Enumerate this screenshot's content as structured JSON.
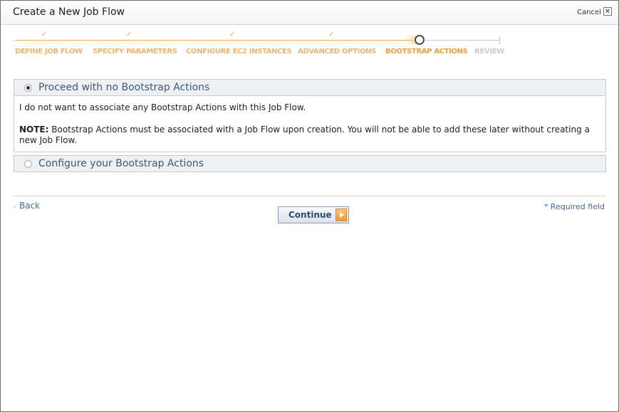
{
  "dialog": {
    "title": "Create a New Job Flow",
    "cancel_label": "Cancel",
    "close_glyph": "✕"
  },
  "wizard": {
    "steps": [
      {
        "label": "DEFINE JOB FLOW",
        "state": "done",
        "marker": "✓"
      },
      {
        "label": "SPECIFY PARAMETERS",
        "state": "done",
        "marker": "✓"
      },
      {
        "label": "CONFIGURE EC2 INSTANCES",
        "state": "done",
        "marker": "✓"
      },
      {
        "label": "ADVANCED OPTIONS",
        "state": "done",
        "marker": "✓"
      },
      {
        "label": "BOOTSTRAP ACTIONS",
        "state": "current"
      },
      {
        "label": "REVIEW",
        "state": "future"
      }
    ],
    "colors": {
      "done": "#f2b46b",
      "current": "#ef9e3c",
      "future": "#c6ccd4"
    }
  },
  "options": [
    {
      "label": "Proceed with no Bootstrap Actions",
      "selected": true,
      "description": "I do not want to associate any Bootstrap Actions with this Job Flow.",
      "note_label": "NOTE:",
      "note_text": " Bootstrap Actions must be associated with a Job Flow upon creation. You will not be able to add these later without creating a new Job Flow."
    },
    {
      "label": "Configure your Bootstrap Actions",
      "selected": false
    }
  ],
  "footer": {
    "back_chevron": "‹",
    "back_label": "Back",
    "required_note": "* Required field",
    "continue_label": "Continue"
  }
}
